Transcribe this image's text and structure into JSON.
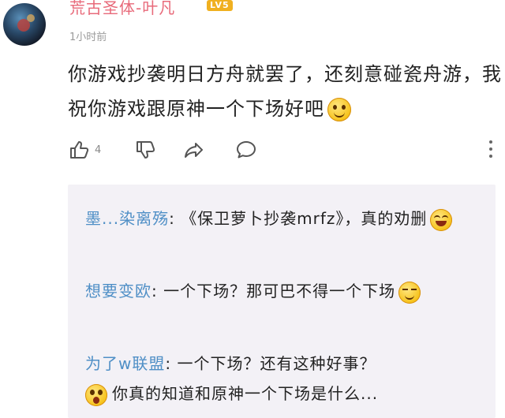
{
  "post": {
    "username": "荒古圣体-叶凡",
    "level_badge": "LV5",
    "time": "1小时前",
    "comment_text": "你游戏抄袭明日方舟就罢了，还刻意碰瓷舟游，我祝你游戏跟原神一个下场好吧",
    "comment_emoji": "smile-emoji"
  },
  "actions": {
    "like_count": "4",
    "like_icon": "thumbs-up-icon",
    "dislike_icon": "thumbs-down-icon",
    "share_icon": "share-icon",
    "reply_icon": "comment-icon",
    "more_icon": "more-vertical-icon"
  },
  "replies": [
    {
      "name": "墨...染离殇",
      "sep": ": ",
      "text": "《保卫萝卜抄袭mrfz》，真的劝删",
      "emoji": "laugh-emoji"
    },
    {
      "name": "想要变欧",
      "sep": ": ",
      "text": "一个下场？那可巴不得一个下场",
      "emoji": "sly-emoji"
    },
    {
      "name": "为了w联盟",
      "sep": ": ",
      "text": "一个下场？还有这种好事？",
      "emoji": "shock-emoji",
      "tail": "你真的知道和原神一个下场是什么..."
    }
  ],
  "colors": {
    "username": "#e86a7a",
    "reply_name": "#4f8fc6",
    "reply_bg": "#f3f1f6",
    "badge": "#f0b020"
  }
}
